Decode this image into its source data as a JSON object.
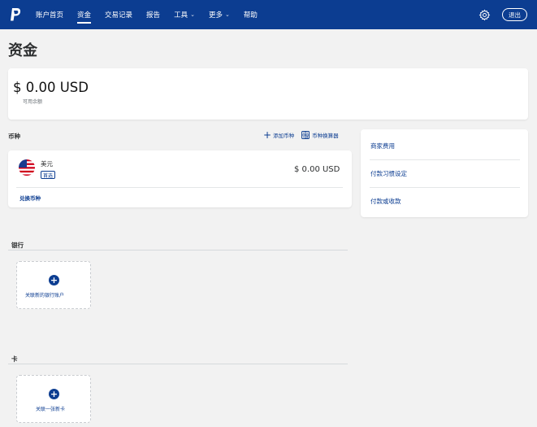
{
  "nav": {
    "items": [
      {
        "label": "账户首页",
        "active": false,
        "dropdown": false
      },
      {
        "label": "资金",
        "active": true,
        "dropdown": false
      },
      {
        "label": "交易记录",
        "active": false,
        "dropdown": false
      },
      {
        "label": "报告",
        "active": false,
        "dropdown": false
      },
      {
        "label": "工具",
        "active": false,
        "dropdown": true
      },
      {
        "label": "更多",
        "active": false,
        "dropdown": true
      },
      {
        "label": "帮助",
        "active": false,
        "dropdown": false
      }
    ],
    "logout_label": "退出",
    "settings_icon": "gear-icon",
    "logo_icon": "paypal-logo-icon"
  },
  "page": {
    "title": "资金"
  },
  "balance": {
    "amount": "$ 0.00 USD",
    "label": "可用余额"
  },
  "currencies": {
    "heading": "币种",
    "add_label": "添加币种",
    "calculator_label": "币种换算器",
    "items": [
      {
        "name": "美元",
        "badge": "首选",
        "amount": "$ 0.00 USD",
        "flag": "us-flag-icon"
      }
    ],
    "convert_label": "兑换币种"
  },
  "side_links": [
    "商家费用",
    "付款习惯设定",
    "付款或收款"
  ],
  "bank": {
    "heading": "银行",
    "add_label": "关联新的银行账户"
  },
  "cards": {
    "heading": "卡",
    "add_label": "关联一张新卡"
  },
  "colors": {
    "brand": "#0c3d91",
    "background": "#f2f2f2"
  }
}
